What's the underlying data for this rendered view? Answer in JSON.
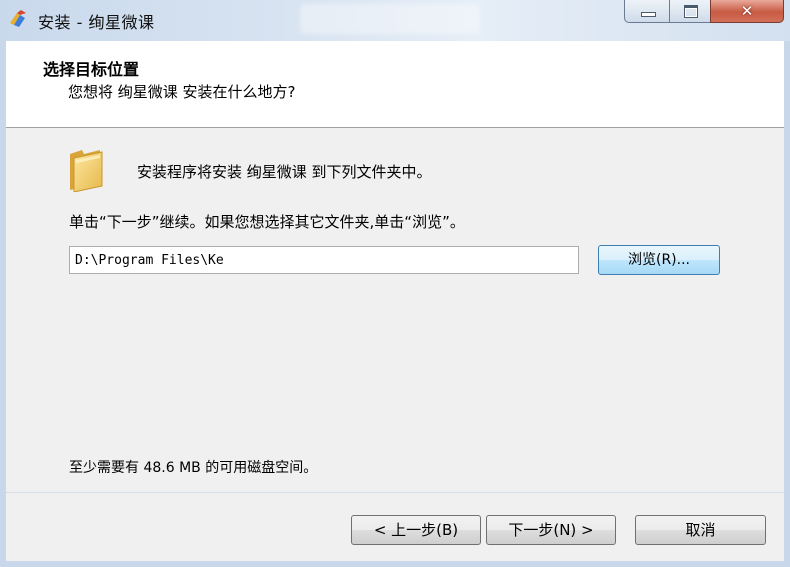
{
  "window": {
    "title": "安装 - 绚星微课",
    "controls": {
      "minimize_icon": "minimize-icon",
      "maximize_icon": "maximize-icon",
      "close_icon": "close-icon",
      "close_glyph": "✕"
    }
  },
  "header": {
    "title": "选择目标位置",
    "subtitle": "您想将 绚星微课 安装在什么地方?"
  },
  "body": {
    "folder_text": "安装程序将安装 绚星微课 到下列文件夹中。",
    "instruction": "单击“下一步”继续。如果您想选择其它文件夹,单击“浏览”。",
    "path_value": "D:\\Program Files\\Ke",
    "browse_label": "浏览(R)...",
    "disk_space": "至少需要有 48.6 MB 的可用磁盘空间。"
  },
  "footer": {
    "back_label": "< 上一步(B)",
    "next_label": "下一步(N) >",
    "cancel_label": "取消"
  },
  "colors": {
    "titlebar": "#d7e3f1",
    "close_button": "#c85b43",
    "browse_button_focus": "#3c7fb1",
    "dialog_background": "#f0f0f0"
  }
}
